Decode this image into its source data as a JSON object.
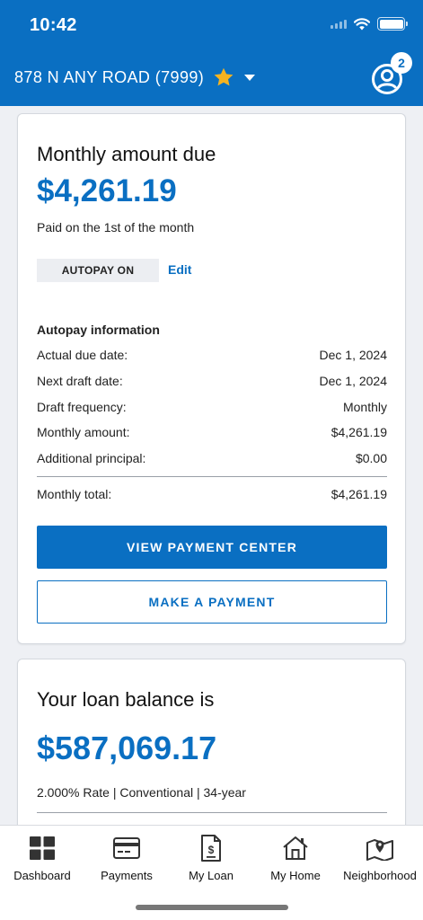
{
  "status_bar": {
    "time": "10:42"
  },
  "header": {
    "property": "878 N ANY ROAD (7999)",
    "notification_count": "2",
    "accent_color": "#0a6fc2",
    "star_color": "#f5b321"
  },
  "payment_card": {
    "title": "Monthly amount due",
    "amount": "$4,261.19",
    "paid_on": "Paid on the 1st of the month",
    "autopay_status": "AUTOPAY ON",
    "edit_label": "Edit",
    "autopay_heading": "Autopay information",
    "rows": [
      {
        "label": "Actual due date:",
        "value": "Dec 1, 2024"
      },
      {
        "label": "Next draft date:",
        "value": "Dec 1, 2024"
      },
      {
        "label": "Draft frequency:",
        "value": "Monthly"
      },
      {
        "label": "Monthly amount:",
        "value": "$4,261.19"
      },
      {
        "label": "Additional principal:",
        "value": "$0.00"
      }
    ],
    "total": {
      "label": "Monthly total:",
      "value": "$4,261.19"
    },
    "primary_button": "VIEW PAYMENT CENTER",
    "secondary_button": "MAKE A PAYMENT"
  },
  "loan_card": {
    "title": "Your loan balance is",
    "balance": "$587,069.17",
    "details": "2.000% Rate | Conventional | 34-year"
  },
  "tabs": [
    {
      "label": "Dashboard",
      "icon": "dashboard-grid-icon"
    },
    {
      "label": "Payments",
      "icon": "credit-card-icon"
    },
    {
      "label": "My Loan",
      "icon": "loan-document-icon"
    },
    {
      "label": "My Home",
      "icon": "house-icon"
    },
    {
      "label": "Neighborhood",
      "icon": "map-pin-icon"
    }
  ]
}
